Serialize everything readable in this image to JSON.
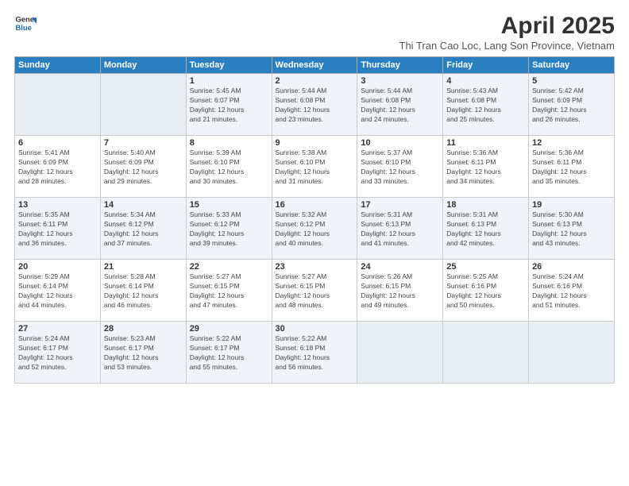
{
  "logo": {
    "line1": "General",
    "line2": "Blue"
  },
  "title": "April 2025",
  "subtitle": "Thi Tran Cao Loc, Lang Son Province, Vietnam",
  "headers": [
    "Sunday",
    "Monday",
    "Tuesday",
    "Wednesday",
    "Thursday",
    "Friday",
    "Saturday"
  ],
  "weeks": [
    [
      {
        "day": "",
        "info": ""
      },
      {
        "day": "",
        "info": ""
      },
      {
        "day": "1",
        "info": "Sunrise: 5:45 AM\nSunset: 6:07 PM\nDaylight: 12 hours\nand 21 minutes."
      },
      {
        "day": "2",
        "info": "Sunrise: 5:44 AM\nSunset: 6:08 PM\nDaylight: 12 hours\nand 23 minutes."
      },
      {
        "day": "3",
        "info": "Sunrise: 5:44 AM\nSunset: 6:08 PM\nDaylight: 12 hours\nand 24 minutes."
      },
      {
        "day": "4",
        "info": "Sunrise: 5:43 AM\nSunset: 6:08 PM\nDaylight: 12 hours\nand 25 minutes."
      },
      {
        "day": "5",
        "info": "Sunrise: 5:42 AM\nSunset: 6:09 PM\nDaylight: 12 hours\nand 26 minutes."
      }
    ],
    [
      {
        "day": "6",
        "info": "Sunrise: 5:41 AM\nSunset: 6:09 PM\nDaylight: 12 hours\nand 28 minutes."
      },
      {
        "day": "7",
        "info": "Sunrise: 5:40 AM\nSunset: 6:09 PM\nDaylight: 12 hours\nand 29 minutes."
      },
      {
        "day": "8",
        "info": "Sunrise: 5:39 AM\nSunset: 6:10 PM\nDaylight: 12 hours\nand 30 minutes."
      },
      {
        "day": "9",
        "info": "Sunrise: 5:38 AM\nSunset: 6:10 PM\nDaylight: 12 hours\nand 31 minutes."
      },
      {
        "day": "10",
        "info": "Sunrise: 5:37 AM\nSunset: 6:10 PM\nDaylight: 12 hours\nand 33 minutes."
      },
      {
        "day": "11",
        "info": "Sunrise: 5:36 AM\nSunset: 6:11 PM\nDaylight: 12 hours\nand 34 minutes."
      },
      {
        "day": "12",
        "info": "Sunrise: 5:36 AM\nSunset: 6:11 PM\nDaylight: 12 hours\nand 35 minutes."
      }
    ],
    [
      {
        "day": "13",
        "info": "Sunrise: 5:35 AM\nSunset: 6:11 PM\nDaylight: 12 hours\nand 36 minutes."
      },
      {
        "day": "14",
        "info": "Sunrise: 5:34 AM\nSunset: 6:12 PM\nDaylight: 12 hours\nand 37 minutes."
      },
      {
        "day": "15",
        "info": "Sunrise: 5:33 AM\nSunset: 6:12 PM\nDaylight: 12 hours\nand 39 minutes."
      },
      {
        "day": "16",
        "info": "Sunrise: 5:32 AM\nSunset: 6:12 PM\nDaylight: 12 hours\nand 40 minutes."
      },
      {
        "day": "17",
        "info": "Sunrise: 5:31 AM\nSunset: 6:13 PM\nDaylight: 12 hours\nand 41 minutes."
      },
      {
        "day": "18",
        "info": "Sunrise: 5:31 AM\nSunset: 6:13 PM\nDaylight: 12 hours\nand 42 minutes."
      },
      {
        "day": "19",
        "info": "Sunrise: 5:30 AM\nSunset: 6:13 PM\nDaylight: 12 hours\nand 43 minutes."
      }
    ],
    [
      {
        "day": "20",
        "info": "Sunrise: 5:29 AM\nSunset: 6:14 PM\nDaylight: 12 hours\nand 44 minutes."
      },
      {
        "day": "21",
        "info": "Sunrise: 5:28 AM\nSunset: 6:14 PM\nDaylight: 12 hours\nand 46 minutes."
      },
      {
        "day": "22",
        "info": "Sunrise: 5:27 AM\nSunset: 6:15 PM\nDaylight: 12 hours\nand 47 minutes."
      },
      {
        "day": "23",
        "info": "Sunrise: 5:27 AM\nSunset: 6:15 PM\nDaylight: 12 hours\nand 48 minutes."
      },
      {
        "day": "24",
        "info": "Sunrise: 5:26 AM\nSunset: 6:15 PM\nDaylight: 12 hours\nand 49 minutes."
      },
      {
        "day": "25",
        "info": "Sunrise: 5:25 AM\nSunset: 6:16 PM\nDaylight: 12 hours\nand 50 minutes."
      },
      {
        "day": "26",
        "info": "Sunrise: 5:24 AM\nSunset: 6:16 PM\nDaylight: 12 hours\nand 51 minutes."
      }
    ],
    [
      {
        "day": "27",
        "info": "Sunrise: 5:24 AM\nSunset: 6:17 PM\nDaylight: 12 hours\nand 52 minutes."
      },
      {
        "day": "28",
        "info": "Sunrise: 5:23 AM\nSunset: 6:17 PM\nDaylight: 12 hours\nand 53 minutes."
      },
      {
        "day": "29",
        "info": "Sunrise: 5:22 AM\nSunset: 6:17 PM\nDaylight: 12 hours\nand 55 minutes."
      },
      {
        "day": "30",
        "info": "Sunrise: 5:22 AM\nSunset: 6:18 PM\nDaylight: 12 hours\nand 56 minutes."
      },
      {
        "day": "",
        "info": ""
      },
      {
        "day": "",
        "info": ""
      },
      {
        "day": "",
        "info": ""
      }
    ]
  ]
}
